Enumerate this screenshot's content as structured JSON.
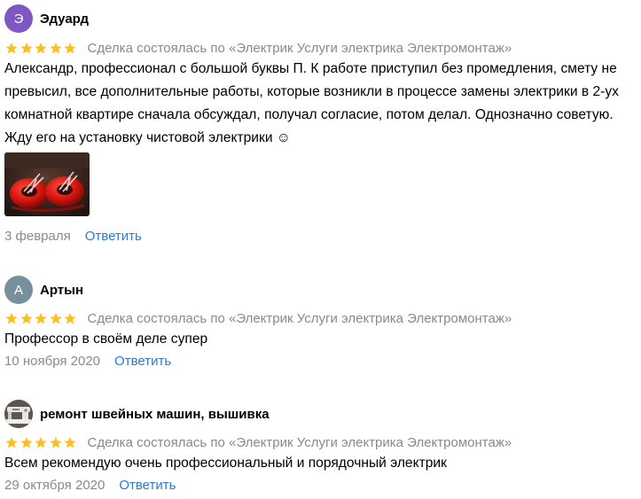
{
  "colors": {
    "star": "#fcbf1e",
    "meta_text": "#8a8a8a",
    "link": "#2a7ad4",
    "avatar_1": "#7e57c2",
    "avatar_2": "#78909c"
  },
  "reviews": [
    {
      "author": "Эдуард",
      "avatar_letter": "Э",
      "rating": 5,
      "deal_text": "Сделка состоялась по «Электрик Услуги электрика Электромонтаж»",
      "text": "Александр, профессионал с большой буквы П. К работе приступил без промедления, смету не превысил, все дополнительные работы, которые возникли в процессе замены электрики в 2-ух комнатной квартире сначала обсуждал, получал согласие, потом делал. Однозначно советую. Жду его на установку чистовой электрики ☺",
      "date": "3 февраля",
      "reply_label": "Ответить",
      "photo_icon": "wire-connectors-photo"
    },
    {
      "author": "Артын",
      "avatar_letter": "А",
      "rating": 5,
      "deal_text": "Сделка состоялась по «Электрик Услуги электрика Электромонтаж»",
      "text": "Профессор в своём деле супер",
      "date": "10 ноября 2020",
      "reply_label": "Ответить"
    },
    {
      "author": "ремонт швейных машин, вышивка",
      "avatar_icon": "sewing-machine-photo",
      "rating": 5,
      "deal_text": "Сделка состоялась по «Электрик Услуги электрика Электромонтаж»",
      "text": "Всем рекомендую очень профессиональный и порядочный электрик",
      "date": "29 октября 2020",
      "reply_label": "Ответить"
    }
  ]
}
